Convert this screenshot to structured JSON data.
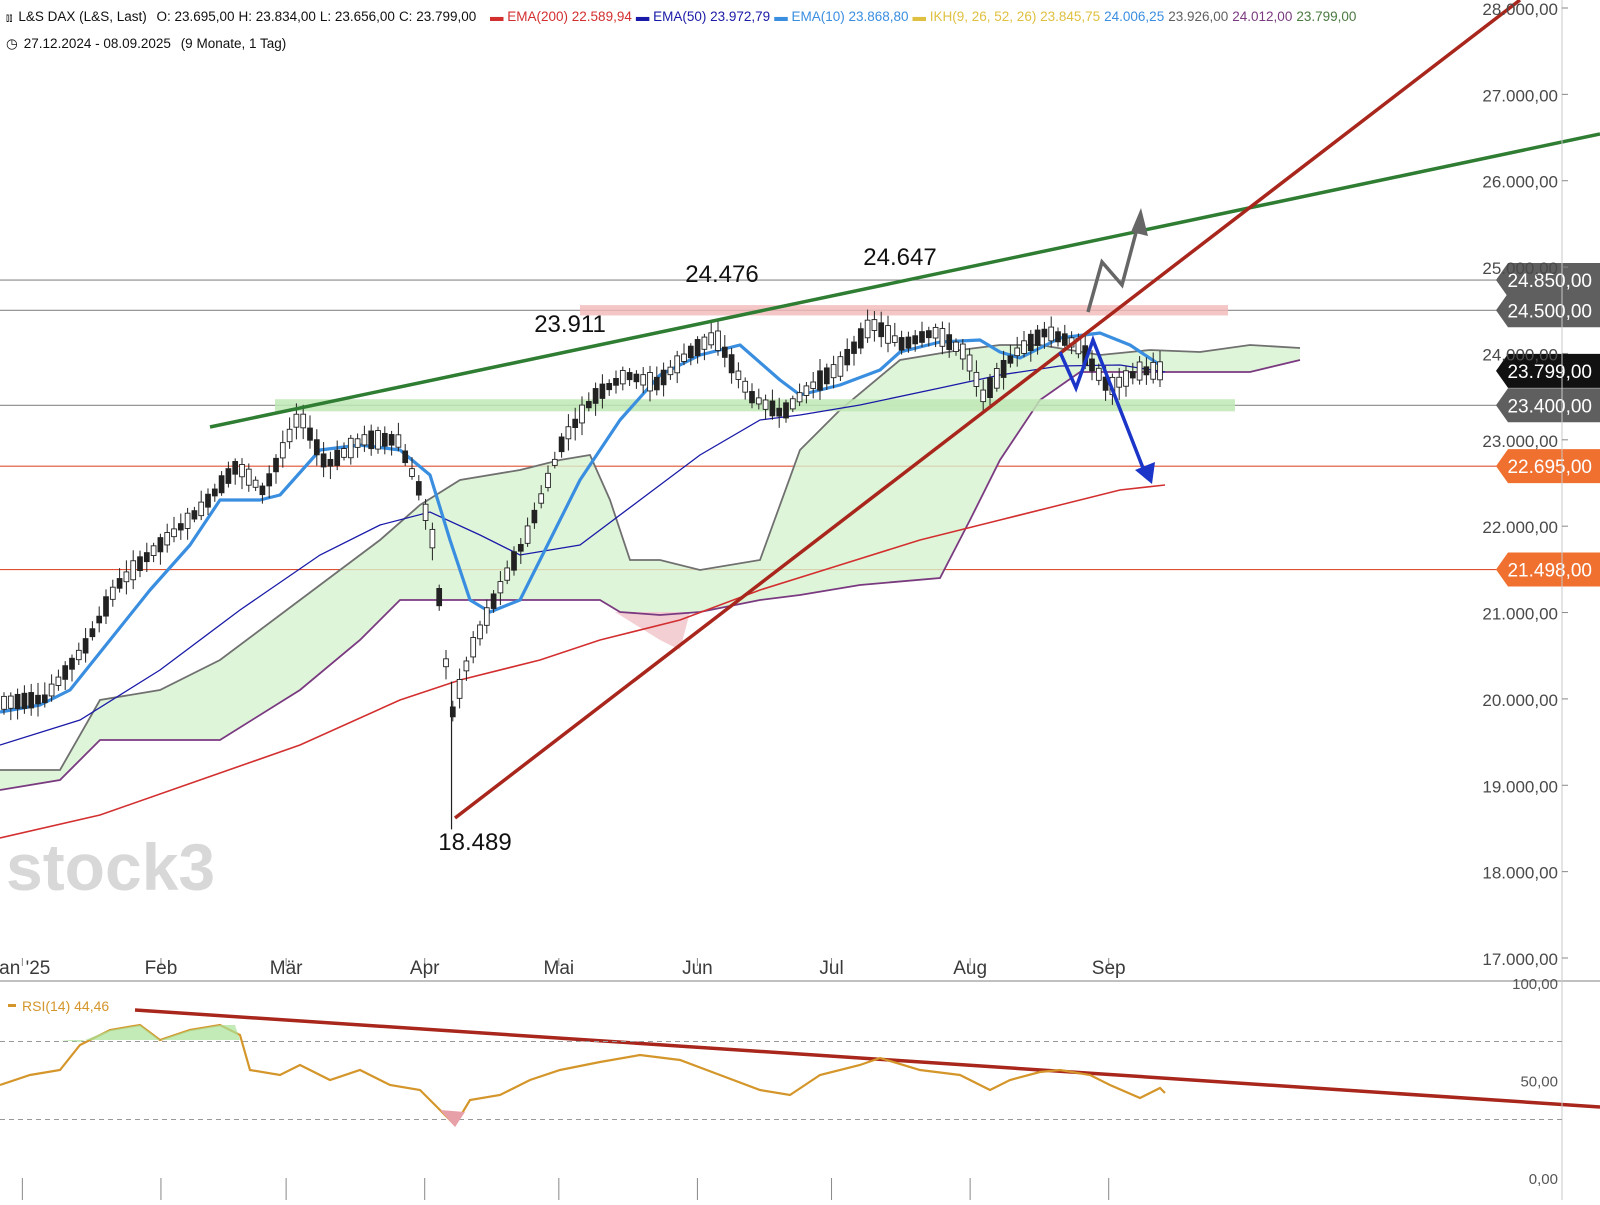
{
  "header": {
    "symbol_icon": "candlestick-chart-icon",
    "symbol": "L&S DAX (L&S, Last)",
    "ohlc": [
      {
        "k": "O:",
        "v": "23.695,00"
      },
      {
        "k": "H:",
        "v": "23.834,00"
      },
      {
        "k": "L:",
        "v": "23.656,00"
      },
      {
        "k": "C:",
        "v": "23.799,00"
      }
    ],
    "indicators": [
      {
        "name": "EMA(200)",
        "value": "22.589,94",
        "color": "#d32f2f"
      },
      {
        "name": "EMA(50)",
        "value": "23.972,79",
        "color": "#1a1aa8"
      },
      {
        "name": "EMA(10)",
        "value": "23.868,80",
        "color": "#3a8ee0"
      },
      {
        "name": "IKH(9, 26, 52, 26)",
        "value": "23.845,75",
        "color": "#e0c040",
        "extra": [
          {
            "v": "24.006,25",
            "color": "#3a8ee0"
          },
          {
            "v": "23.926,00",
            "color": "#606060"
          },
          {
            "v": "24.012,00",
            "color": "#7a3a80"
          },
          {
            "v": "23.799,00",
            "color": "#4a7a40"
          }
        ]
      }
    ],
    "clock_icon": "clock-icon",
    "range": "27.12.2024 - 08.09.2025",
    "period": "(9 Monate, 1 Tag)"
  },
  "chart_data": [
    {
      "type": "candlestick",
      "title": "L&S DAX (L&S, Last)",
      "x_months": [
        "Jan '25",
        "Feb",
        "Mär",
        "Apr",
        "Mai",
        "Jun",
        "Jul",
        "Aug",
        "Sep"
      ],
      "y_ticks": [
        "17.000,00",
        "18.000,00",
        "19.000,00",
        "20.000,00",
        "21.000,00",
        "22.000,00",
        "23.000,00",
        "24.000,00",
        "25.000,00",
        "26.000,00",
        "27.000,00",
        "28.000,00"
      ],
      "ylim": [
        17000,
        28000
      ],
      "annotations": [
        {
          "text": "18.489",
          "value": 18489,
          "date": "2025-04-07"
        },
        {
          "text": "23.911",
          "value": 23911,
          "date": "2025-05-02"
        },
        {
          "text": "24.476",
          "value": 24476,
          "date": "2025-06-05"
        },
        {
          "text": "24.647",
          "value": 24647,
          "date": "2025-07-10"
        }
      ],
      "price_tags": [
        {
          "text": "24.850,00",
          "value": 24850,
          "style": "gray"
        },
        {
          "text": "24.500,00",
          "value": 24500,
          "style": "gray"
        },
        {
          "text": "23.799,00",
          "value": 23799,
          "style": "black"
        },
        {
          "text": "23.400,00",
          "value": 23400,
          "style": "gray"
        },
        {
          "text": "22.695,00",
          "value": 22695,
          "style": "orange"
        },
        {
          "text": "21.498,00",
          "value": 21498,
          "style": "orange"
        }
      ],
      "watermark": "stock3",
      "indicator_legend": [
        "EMA(200)",
        "EMA(50)",
        "EMA(10)",
        "IKH(9, 26, 52, 26)"
      ]
    },
    {
      "type": "line",
      "title": "RSI(14) 44,46",
      "series": [
        {
          "name": "RSI(14)",
          "last": 44.46
        }
      ],
      "y_ticks": [
        "0,00",
        "50,00",
        "100,00"
      ],
      "ylim": [
        0,
        100
      ],
      "reference_lines": [
        30,
        70
      ]
    }
  ],
  "colors": {
    "ema200": "#d32f2f",
    "ema50": "#1a1aa8",
    "ema10": "#3a8ee0",
    "trend_green": "#2e7d32",
    "trend_red": "#a8261c",
    "rsi": "#d4962a",
    "tag_orange": "#f07030",
    "tag_gray": "#5f5f5f"
  }
}
